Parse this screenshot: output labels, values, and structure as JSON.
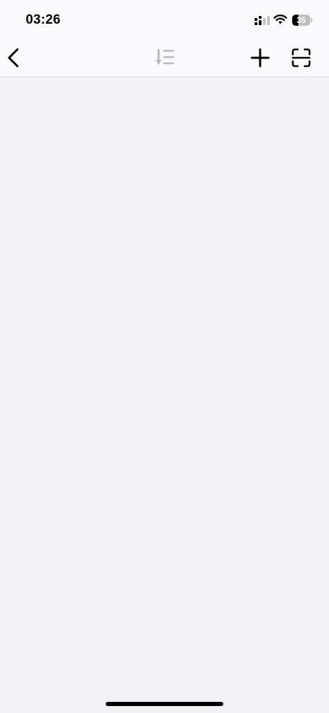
{
  "status_bar": {
    "time": "03:26",
    "battery_percent": "35",
    "battery_level": 0.35,
    "signal_icon": "cellular-signal-icon",
    "wifi_icon": "wifi-icon"
  },
  "nav_bar": {
    "back_icon": "chevron-left-icon",
    "sort_icon": "sort-descending-icon",
    "add_icon": "plus-icon",
    "scan_icon": "scan-icon",
    "sort_disabled_color": "#b8b8bc",
    "icon_color": "#000000"
  },
  "colors": {
    "background": "#f2f1f6",
    "header_background": "#f9f9fb"
  }
}
